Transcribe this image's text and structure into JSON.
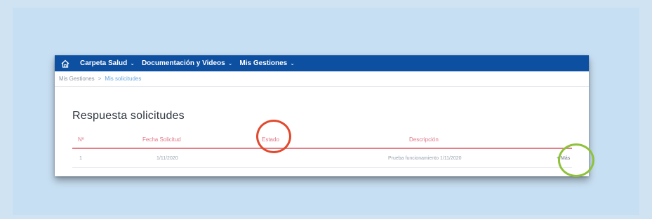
{
  "navbar": {
    "home_icon": "home-icon",
    "items": [
      {
        "label": "Carpeta Salud",
        "icon": "chevron-down-icon"
      },
      {
        "label": "Documentación y Videos",
        "icon": "chevron-down-icon"
      },
      {
        "label": "Mis Gestiones",
        "icon": "chevron-down-icon"
      }
    ],
    "color": "#0d4fa0"
  },
  "breadcrumb": {
    "items": [
      "Mis Gestiones",
      "Mis solicitudes"
    ],
    "separator": ">"
  },
  "page": {
    "title": "Respuesta solicitudes"
  },
  "table": {
    "columns": [
      "Nº",
      "Fecha Solicitud",
      "Estado",
      "Descripción",
      ""
    ],
    "rows": [
      [
        "1",
        "1/11/2020",
        "",
        "Prueba funcionamiento 1/11/2020",
        "+ Más"
      ]
    ],
    "header_color": "#e07888"
  },
  "annotations": {
    "red_circle_color": "#e24a2f",
    "green_circle_color": "#8fc23a"
  }
}
